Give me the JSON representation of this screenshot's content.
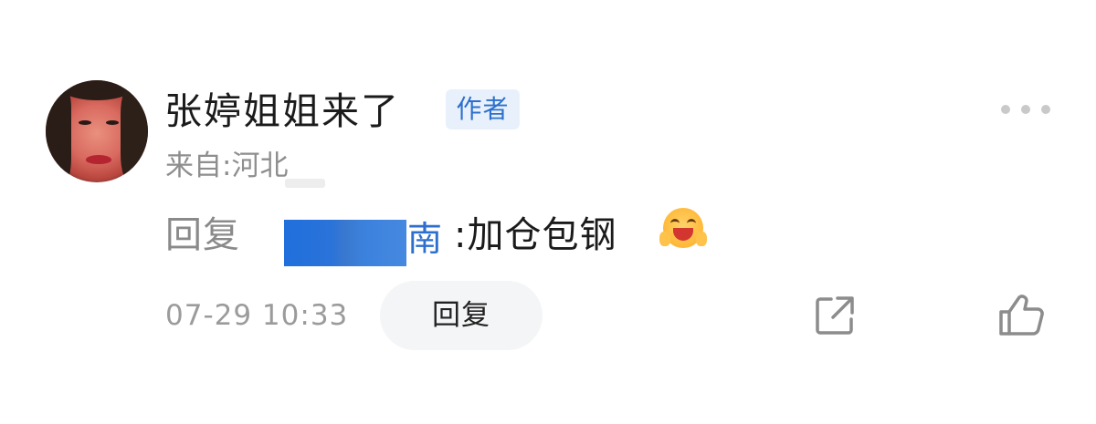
{
  "comment": {
    "username": "张婷姐姐来了",
    "author_badge": "作者",
    "location": "来自:河北",
    "reply_prefix": "回复",
    "reply_target_visible_tail": "南",
    "reply_content": ":加仓包钢",
    "emoji": "laughing-emoji",
    "timestamp": "07-29 10:33",
    "reply_button_label": "回复"
  },
  "icons": {
    "more": "more-dots-icon",
    "share": "share-icon",
    "like": "thumbs-up-icon"
  },
  "colors": {
    "accent": "#2d6fcd",
    "badge_bg": "#e8f1fb",
    "muted_text": "#8e8e8e",
    "primary_text": "#1b1b1b",
    "reply_button_bg": "#f4f5f7"
  }
}
